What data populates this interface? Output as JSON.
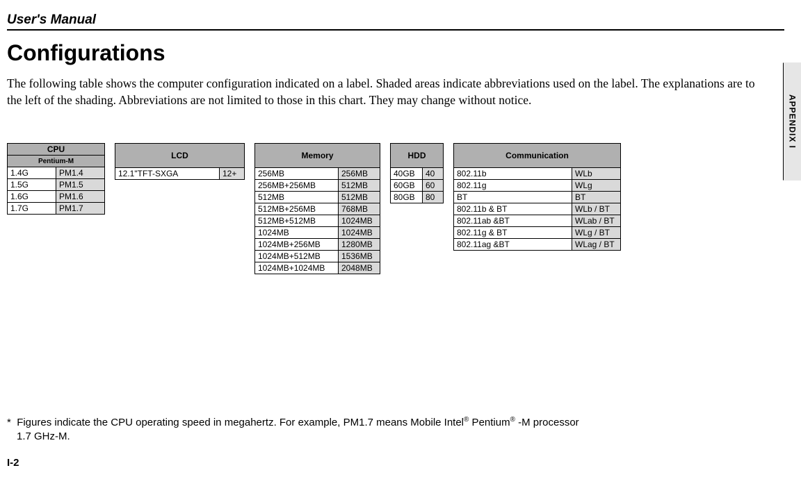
{
  "header": "User's Manual",
  "sideTab": "APPENDIX I",
  "sectionTitle": "Configurations",
  "intro": "The following table shows the computer configuration indicated on a label. Shaded areas indicate abbreviations used on the label. The explanations are to the left of the shading. Abbreviations are not limited to those in this chart. They may change without notice.",
  "cpu": {
    "head": "CPU",
    "sub": "Pentium-M",
    "rows": [
      [
        "1.4G",
        "PM1.4"
      ],
      [
        "1.5G",
        "PM1.5"
      ],
      [
        "1.6G",
        "PM1.6"
      ],
      [
        "1.7G",
        "PM1.7"
      ]
    ]
  },
  "lcd": {
    "head": "LCD",
    "rows": [
      [
        "12.1\"TFT-SXGA",
        "12+"
      ]
    ]
  },
  "memory": {
    "head": "Memory",
    "rows": [
      [
        "256MB",
        "256MB"
      ],
      [
        "256MB+256MB",
        "512MB"
      ],
      [
        "512MB",
        "512MB"
      ],
      [
        "512MB+256MB",
        "768MB"
      ],
      [
        "512MB+512MB",
        "1024MB"
      ],
      [
        "1024MB",
        "1024MB"
      ],
      [
        "1024MB+256MB",
        "1280MB"
      ],
      [
        "1024MB+512MB",
        "1536MB"
      ],
      [
        "1024MB+1024MB",
        "2048MB"
      ]
    ]
  },
  "hdd": {
    "head": "HDD",
    "rows": [
      [
        "40GB",
        "40"
      ],
      [
        "60GB",
        "60"
      ],
      [
        "80GB",
        "80"
      ]
    ]
  },
  "comm": {
    "head": "Communication",
    "rows": [
      [
        "802.11b",
        "WLb"
      ],
      [
        "802.11g",
        "WLg"
      ],
      [
        "BT",
        "BT"
      ],
      [
        "802.11b & BT",
        "WLb / BT"
      ],
      [
        "802.11ab &BT",
        "WLab / BT"
      ],
      [
        "802.11g & BT",
        "WLg / BT"
      ],
      [
        "802.11ag &BT",
        "WLag / BT"
      ]
    ]
  },
  "footnote": {
    "star": "*",
    "line1": "Figures indicate the CPU operating speed in megahertz. For example, PM1.7 means Mobile Intel",
    "reg1": "®",
    "mid": " Pentium",
    "reg2": "®",
    "tail": " -M processor",
    "line2": "1.7 GHz-M."
  },
  "pageNum": "I-2"
}
